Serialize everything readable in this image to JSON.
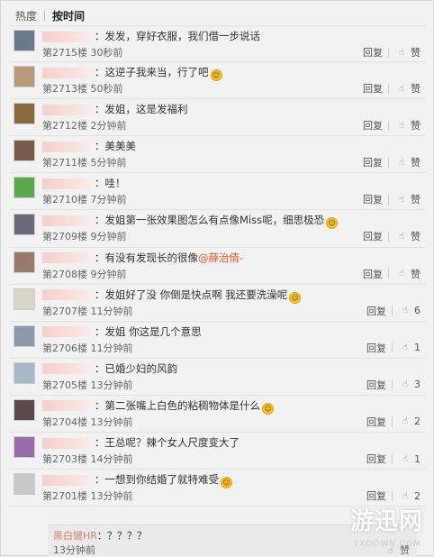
{
  "tabs": {
    "hot": "热度",
    "time": "按时间"
  },
  "actions": {
    "reply": "回复",
    "like": "赞"
  },
  "comments": [
    {
      "content": "发发，穿好衣服，我们借一步说话",
      "emoji": false,
      "mention": "",
      "floor_time": "第2715楼 30秒前",
      "likes": "赞",
      "avatar_color": "#6b7a8a"
    },
    {
      "content": "这逆子我来当，行了吧",
      "emoji": true,
      "mention": "",
      "floor_time": "第2713楼 50秒前",
      "likes": "赞",
      "avatar_color": "#b89a7a"
    },
    {
      "content": "发姐，这是发福利",
      "emoji": false,
      "mention": "",
      "floor_time": "第2712楼 2分钟前",
      "likes": "赞",
      "avatar_color": "#8a6a3a"
    },
    {
      "content": "美美美",
      "emoji": false,
      "mention": "",
      "floor_time": "第2711楼 5分钟前",
      "likes": "赞",
      "avatar_color": "#7a5a4a"
    },
    {
      "content": "哇！",
      "emoji": false,
      "mention": "",
      "floor_time": "第2710楼 7分钟前",
      "likes": "赞",
      "avatar_color": "#5aa84a"
    },
    {
      "content": "发姐第一张效果图怎么有点像Miss呢，细思极恐",
      "emoji": true,
      "mention": "",
      "floor_time": "第2709楼 9分钟前",
      "likes": "赞",
      "avatar_color": "#6a6a7a"
    },
    {
      "content": "有没有发现长的很像",
      "emoji": false,
      "mention": "@薛治倩-",
      "floor_time": "第2708楼 9分钟前",
      "likes": "赞",
      "avatar_color": "#9a7a6a"
    },
    {
      "content": "发姐好了没 你倒是快点啊 我还要洗澡呢",
      "emoji": true,
      "mention": "",
      "floor_time": "第2707楼 11分钟前",
      "likes": "6",
      "avatar_color": "#d8d8c8"
    },
    {
      "content": "发姐 你这是几个意思",
      "emoji": false,
      "mention": "",
      "floor_time": "第2706楼 11分钟前",
      "likes": "1",
      "avatar_color": "#8a9aaa"
    },
    {
      "content": "已婚少妇的风韵",
      "emoji": false,
      "mention": "",
      "floor_time": "第2705楼 13分钟前",
      "likes": "3",
      "avatar_color": "#a8b8c8"
    },
    {
      "content": "第二张嘴上白色的粘稠物体是什么",
      "emoji": true,
      "mention": "",
      "floor_time": "第2704楼 13分钟前",
      "likes": "2",
      "avatar_color": "#5a4a4a"
    },
    {
      "content": "王总呢？辣个女人尺度变大了",
      "emoji": false,
      "mention": "",
      "floor_time": "第2703楼 14分钟前",
      "likes": "1",
      "avatar_color": "#9a6aaa"
    },
    {
      "content": "一想到你结婚了就特难受",
      "emoji": true,
      "mention": "",
      "floor_time": "第2701楼 13分钟前",
      "likes": "2",
      "avatar_color": "#c8c8c8"
    }
  ],
  "subreply": {
    "name": "黑白键HR",
    "text": "：？？？？",
    "time": "13分钟前",
    "like": "赞"
  },
  "watermark": {
    "main": "游迅网",
    "sub": "YXDOWN.COM"
  }
}
